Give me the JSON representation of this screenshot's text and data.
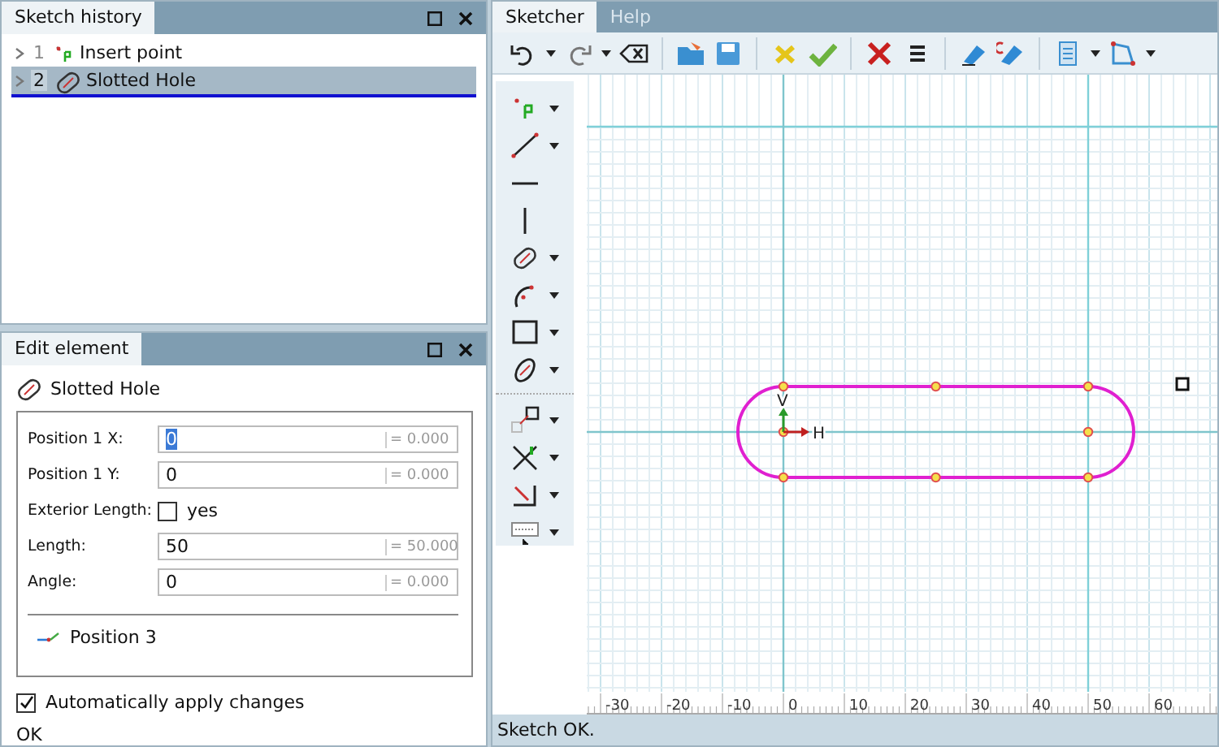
{
  "history_panel": {
    "title": "Sketch history",
    "items": [
      {
        "index": "1",
        "label": "Insert point",
        "selected": false
      },
      {
        "index": "2",
        "label": "Slotted Hole",
        "selected": true
      }
    ]
  },
  "edit_panel": {
    "title": "Edit element",
    "element": "Slotted Hole",
    "fields": [
      {
        "kind": "number",
        "label": "Position 1 X:",
        "value": "0",
        "result": "= 0.000",
        "focused": true
      },
      {
        "kind": "number",
        "label": "Position 1 Y:",
        "value": "0",
        "result": "= 0.000",
        "focused": false
      },
      {
        "kind": "checkbox",
        "label": "Exterior Length:",
        "option": "yes",
        "checked": false
      },
      {
        "kind": "number",
        "label": "Length:",
        "value": "50",
        "result": "= 50.000",
        "focused": false
      },
      {
        "kind": "number",
        "label": "Angle:",
        "value": "0",
        "result": "= 0.000",
        "focused": false
      }
    ],
    "sub_item": "Position 3",
    "auto_apply": {
      "label": "Automatically apply changes",
      "checked": true
    },
    "status": "OK"
  },
  "tabs": [
    {
      "label": "Sketcher",
      "selected": true
    },
    {
      "label": "Help",
      "selected": false
    }
  ],
  "canvas": {
    "axis_labels": [
      "V",
      "H"
    ],
    "ruler_labels": [
      "-30",
      "-20",
      "-10",
      "0",
      "10",
      "20",
      "30",
      "40",
      "50",
      "60"
    ]
  },
  "status_bar": "Sketch OK."
}
